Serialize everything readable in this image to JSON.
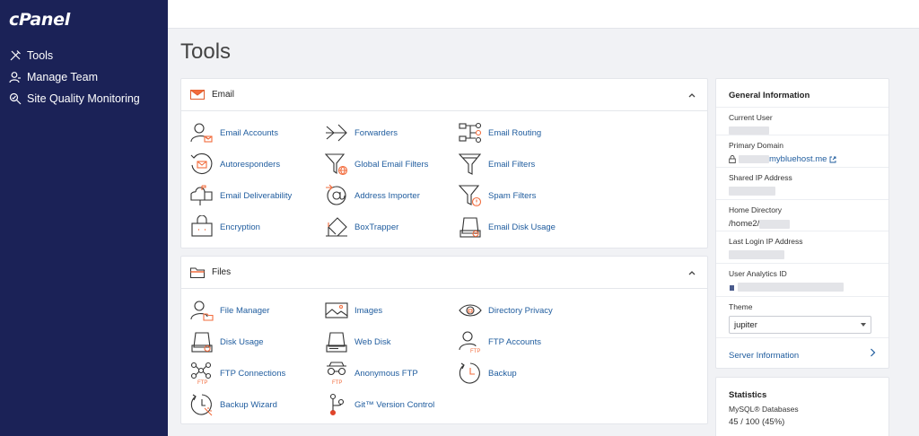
{
  "app": {
    "logo": "cPanel"
  },
  "sidebar": {
    "items": [
      {
        "label": "Tools",
        "icon": "tools-icon"
      },
      {
        "label": "Manage Team",
        "icon": "team-icon"
      },
      {
        "label": "Site Quality Monitoring",
        "icon": "monitor-icon"
      }
    ]
  },
  "page": {
    "title": "Tools"
  },
  "email": {
    "title": "Email",
    "tools": [
      {
        "label": "Email Accounts",
        "icon": "user-mail-icon"
      },
      {
        "label": "Forwarders",
        "icon": "forward-arrow-icon"
      },
      {
        "label": "Email Routing",
        "icon": "routing-icon"
      },
      {
        "label": "Autoresponders",
        "icon": "autoresponder-icon"
      },
      {
        "label": "Global Email Filters",
        "icon": "global-filter-icon"
      },
      {
        "label": "Email Filters",
        "icon": "filter-icon"
      },
      {
        "label": "Email Deliverability",
        "icon": "mailbox-icon"
      },
      {
        "label": "Address Importer",
        "icon": "at-import-icon"
      },
      {
        "label": "Spam Filters",
        "icon": "spam-filter-icon"
      },
      {
        "label": "Encryption",
        "icon": "encryption-icon"
      },
      {
        "label": "BoxTrapper",
        "icon": "boxtrapper-icon"
      },
      {
        "label": "Email Disk Usage",
        "icon": "disk-usage-icon"
      }
    ]
  },
  "files": {
    "title": "Files",
    "tools": [
      {
        "label": "File Manager",
        "icon": "file-manager-icon"
      },
      {
        "label": "Images",
        "icon": "images-icon"
      },
      {
        "label": "Directory Privacy",
        "icon": "eye-icon"
      },
      {
        "label": "Disk Usage",
        "icon": "disk-icon"
      },
      {
        "label": "Web Disk",
        "icon": "web-disk-icon"
      },
      {
        "label": "FTP Accounts",
        "icon": "ftp-user-icon"
      },
      {
        "label": "FTP Connections",
        "icon": "ftp-connections-icon"
      },
      {
        "label": "Anonymous FTP",
        "icon": "anonymous-ftp-icon"
      },
      {
        "label": "Backup",
        "icon": "backup-icon"
      },
      {
        "label": "Backup Wizard",
        "icon": "backup-wizard-icon"
      },
      {
        "label": "Git™ Version Control",
        "icon": "git-icon"
      }
    ]
  },
  "general_info": {
    "title": "General Information",
    "current_user_label": "Current User",
    "primary_domain_label": "Primary Domain",
    "primary_domain_value": "mybluehost.me",
    "shared_ip_label": "Shared IP Address",
    "home_dir_label": "Home Directory",
    "home_dir_value": "/home2/",
    "last_login_label": "Last Login IP Address",
    "analytics_label": "User Analytics ID",
    "theme_label": "Theme",
    "theme_value": "jupiter",
    "server_info_label": "Server Information"
  },
  "statistics": {
    "title": "Statistics",
    "mysql_label": "MySQL® Databases",
    "mysql_value": "45 / 100  (45%)"
  },
  "colors": {
    "sidebar": "#1b2257",
    "link": "#1f5c9e",
    "accent": "#f26c3d"
  }
}
